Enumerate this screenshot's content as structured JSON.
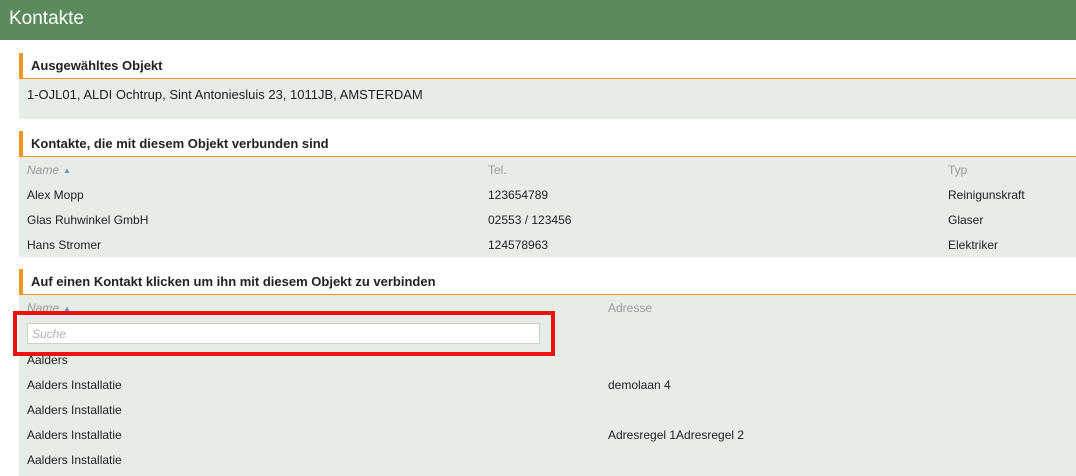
{
  "window": {
    "title": "Kontakte"
  },
  "selected_object": {
    "heading": "Ausgewähltes Objekt",
    "text": "1-OJL01, ALDI Ochtrup, Sint Antoniesluis 23, 1011JB, AMSTERDAM"
  },
  "linked_contacts": {
    "heading": "Kontakte, die mit diesem Objekt verbunden sind",
    "columns": {
      "name": "Name",
      "tel": "Tel.",
      "type": "Typ"
    },
    "rows": [
      {
        "name": "Alex Mopp",
        "tel": "123654789",
        "type": "Reinigunskraft"
      },
      {
        "name": "Glas Ruhwinkel GmbH",
        "tel": "02553 / 123456",
        "type": "Glaser"
      },
      {
        "name": "Hans Stromer",
        "tel": "124578963",
        "type": "Elektriker"
      }
    ]
  },
  "available_contacts": {
    "heading": "Auf einen Kontakt klicken um ihn mit diesem Objekt zu verbinden",
    "columns": {
      "name": "Name",
      "address": "Adresse"
    },
    "search": {
      "placeholder": "Suche",
      "value": ""
    },
    "rows": [
      {
        "name": "Aalders",
        "address": ""
      },
      {
        "name": "Aalders Installatie",
        "address": "demolaan 4"
      },
      {
        "name": "Aalders Installatie",
        "address": ""
      },
      {
        "name": "Aalders Installatie",
        "address": "Adresregel 1Adresregel 2"
      },
      {
        "name": "Aalders Installatie",
        "address": ""
      }
    ]
  },
  "icons": {
    "sort_ascending": "sort-ascending-icon"
  },
  "colors": {
    "titlebar": "#5b8a5c",
    "accent": "#f0961e",
    "panel": "#e6ece6",
    "highlight": "#ee1111"
  }
}
